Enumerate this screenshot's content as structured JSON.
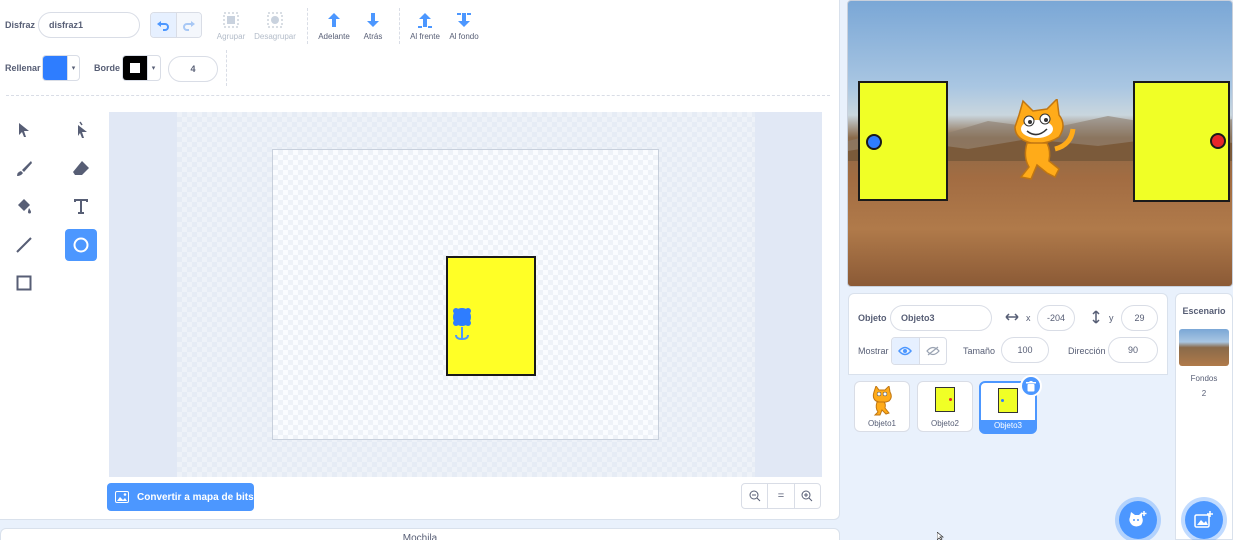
{
  "toolbar": {
    "costume_label": "Disfraz",
    "costume_name": "disfraz1",
    "group": "Agrupar",
    "ungroup": "Desagrupar",
    "forward": "Adelante",
    "backward": "Atrás",
    "front": "Al frente",
    "back": "Al fondo",
    "fill_label": "Rellenar",
    "outline_label": "Borde",
    "outline_size": "4",
    "fill_color": "#2e7dff",
    "outline_color": "#000000"
  },
  "tools": [
    "select-tool",
    "reshape-tool",
    "brush-tool",
    "eraser-tool",
    "fill-tool",
    "text-tool",
    "line-tool",
    "circle-tool",
    "rect-tool"
  ],
  "canvas": {
    "convert_label": "Convertir a mapa de bits",
    "zoom_out": "−",
    "zoom_reset": "=",
    "zoom_in": "+"
  },
  "backpack_label": "Mochila",
  "sprite_info": {
    "sprite_label": "Objeto",
    "sprite_name": "Objeto3",
    "x_label": "x",
    "x_value": "-204",
    "y_label": "y",
    "y_value": "29",
    "show_label": "Mostrar",
    "size_label": "Tamaño",
    "size_value": "100",
    "direction_label": "Dirección",
    "direction_value": "90"
  },
  "sprites": [
    {
      "name": "Objeto1"
    },
    {
      "name": "Objeto2"
    },
    {
      "name": "Objeto3"
    }
  ],
  "stage_panel": {
    "header": "Escenario",
    "backdrops_label": "Fondos",
    "backdrops_count": "2"
  },
  "colors": {
    "accent": "#4c97ff",
    "door_yellow": "#f0ff26",
    "blue_dot": "#2e7dff",
    "red_dot": "#e8262a"
  }
}
